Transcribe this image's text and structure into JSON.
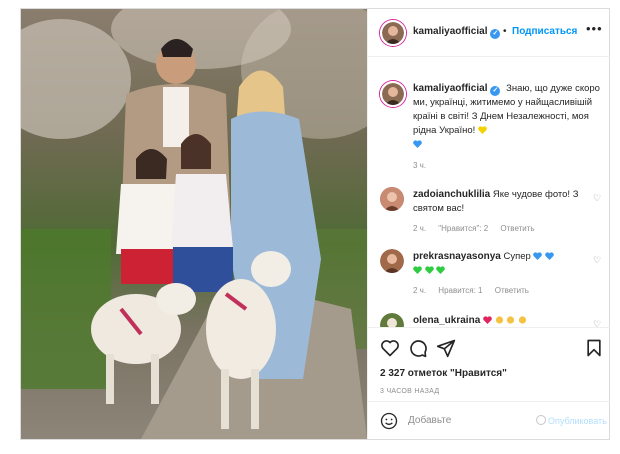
{
  "post": {
    "author": "kamaliyaofficial",
    "follow_label": "Подписаться",
    "separator": "•",
    "more_label": "•••",
    "caption": "Знаю, що дуже скоро ми, українці, житимемо у найщасливішій країні в світі! З Днем Незалежності, моя рідна Україно!",
    "caption_time": "3 ч.",
    "comments": [
      {
        "user": "zadoianchuklilia",
        "text": "Яке чудове фото! З святом вас!",
        "time": "2 ч.",
        "likes": "\"Нравится\": 2",
        "reply": "Ответить",
        "avatar_color": "#b0707a"
      },
      {
        "user": "prekrasnayasonya",
        "text": "Супер",
        "time": "2 ч.",
        "likes": "Нравится: 1",
        "reply": "Ответить",
        "avatar_color": "#a06a4a"
      },
      {
        "user": "olena_ukraina",
        "text": "",
        "avatar_color": "#5f7a3a"
      }
    ],
    "likes_count": "2 327 отметок \"Нравится\"",
    "date": "3 ЧАСОВ НАЗАД",
    "comment_placeholder": "Добавьте",
    "publish_label": "Опубликовать"
  },
  "icons": {
    "verified": "✓",
    "heart": "heart-icon",
    "comment": "comment-icon",
    "share": "share-icon",
    "save": "bookmark-icon",
    "emoji": "emoji-icon"
  },
  "colors": {
    "link": "#0095f6",
    "verified": "#3897f0",
    "muted": "#8e8e8e",
    "heart_blue": "#3897f0",
    "heart_yellow": "#f5d100",
    "heart_green": "#2ecc40",
    "heart_red": "#e0245e"
  }
}
